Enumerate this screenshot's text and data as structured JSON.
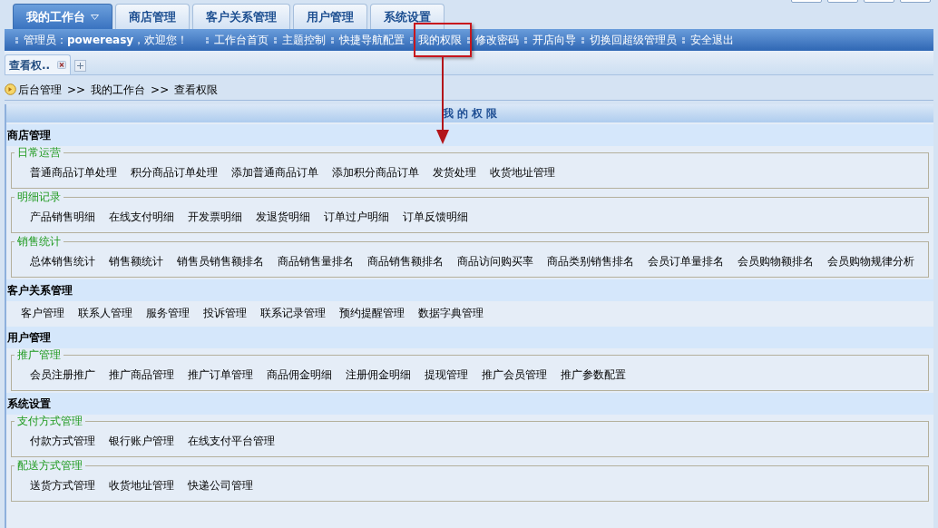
{
  "tabs": [
    {
      "label": "我的工作台",
      "selected": true,
      "has_menu": true
    },
    {
      "label": "商店管理",
      "selected": false,
      "has_menu": false
    },
    {
      "label": "客户关系管理",
      "selected": false,
      "has_menu": false
    },
    {
      "label": "用户管理",
      "selected": false,
      "has_menu": false
    },
    {
      "label": "系统设置",
      "selected": false,
      "has_menu": false
    }
  ],
  "nav_bar": {
    "welcome": "管理员：**powereasy**，欢迎您！",
    "links": [
      {
        "label": "工作台首页",
        "highlighted": false
      },
      {
        "label": "主题控制",
        "highlighted": false
      },
      {
        "label": "快捷导航配置",
        "highlighted": false
      },
      {
        "label": "我的权限",
        "highlighted": true
      },
      {
        "label": "修改密码",
        "highlighted": false
      },
      {
        "label": "开店向导",
        "highlighted": false
      },
      {
        "label": "切换回超级管理员",
        "highlighted": false
      },
      {
        "label": "安全退出",
        "highlighted": false
      }
    ]
  },
  "doc_tabs": [
    {
      "label": "查看权..",
      "selected": true
    }
  ],
  "breadcrumb": [
    "后台管理",
    ">>",
    "我的工作台",
    ">>",
    "查看权限"
  ],
  "panel_title": "我 的 权 限",
  "sections": [
    {
      "title": "商店管理",
      "kind": "grouped",
      "groups": [
        {
          "legend": "日常运营",
          "items": [
            "普通商品订单处理",
            "积分商品订单处理",
            "添加普通商品订单",
            "添加积分商品订单",
            "发货处理",
            "收货地址管理"
          ]
        },
        {
          "legend": "明细记录",
          "items": [
            "产品销售明细",
            "在线支付明细",
            "开发票明细",
            "发退货明细",
            "订单过户明细",
            "订单反馈明细"
          ]
        },
        {
          "legend": "销售统计",
          "items": [
            "总体销售统计",
            "销售额统计",
            "销售员销售额排名",
            "商品销售量排名",
            "商品销售额排名",
            "商品访问购买率",
            "商品类别销售排名",
            "会员订单量排名",
            "会员购物额排名",
            "会员购物规律分析"
          ]
        }
      ]
    },
    {
      "title": "客户关系管理",
      "kind": "flat",
      "items": [
        "客户管理",
        "联系人管理",
        "服务管理",
        "投诉管理",
        "联系记录管理",
        "预约提醒管理",
        "数据字典管理"
      ]
    },
    {
      "title": "用户管理",
      "kind": "grouped",
      "groups": [
        {
          "legend": "推广管理",
          "items": [
            "会员注册推广",
            "推广商品管理",
            "推广订单管理",
            "商品佣金明细",
            "注册佣金明细",
            "提现管理",
            "推广会员管理",
            "推广参数配置"
          ]
        }
      ]
    },
    {
      "title": "系统设置",
      "kind": "grouped",
      "groups": [
        {
          "legend": "支付方式管理",
          "items": [
            "付款方式管理",
            "银行账户管理",
            "在线支付平台管理"
          ]
        },
        {
          "legend": "配送方式管理",
          "items": [
            "送货方式管理",
            "收货地址管理",
            "快递公司管理"
          ]
        }
      ]
    }
  ]
}
